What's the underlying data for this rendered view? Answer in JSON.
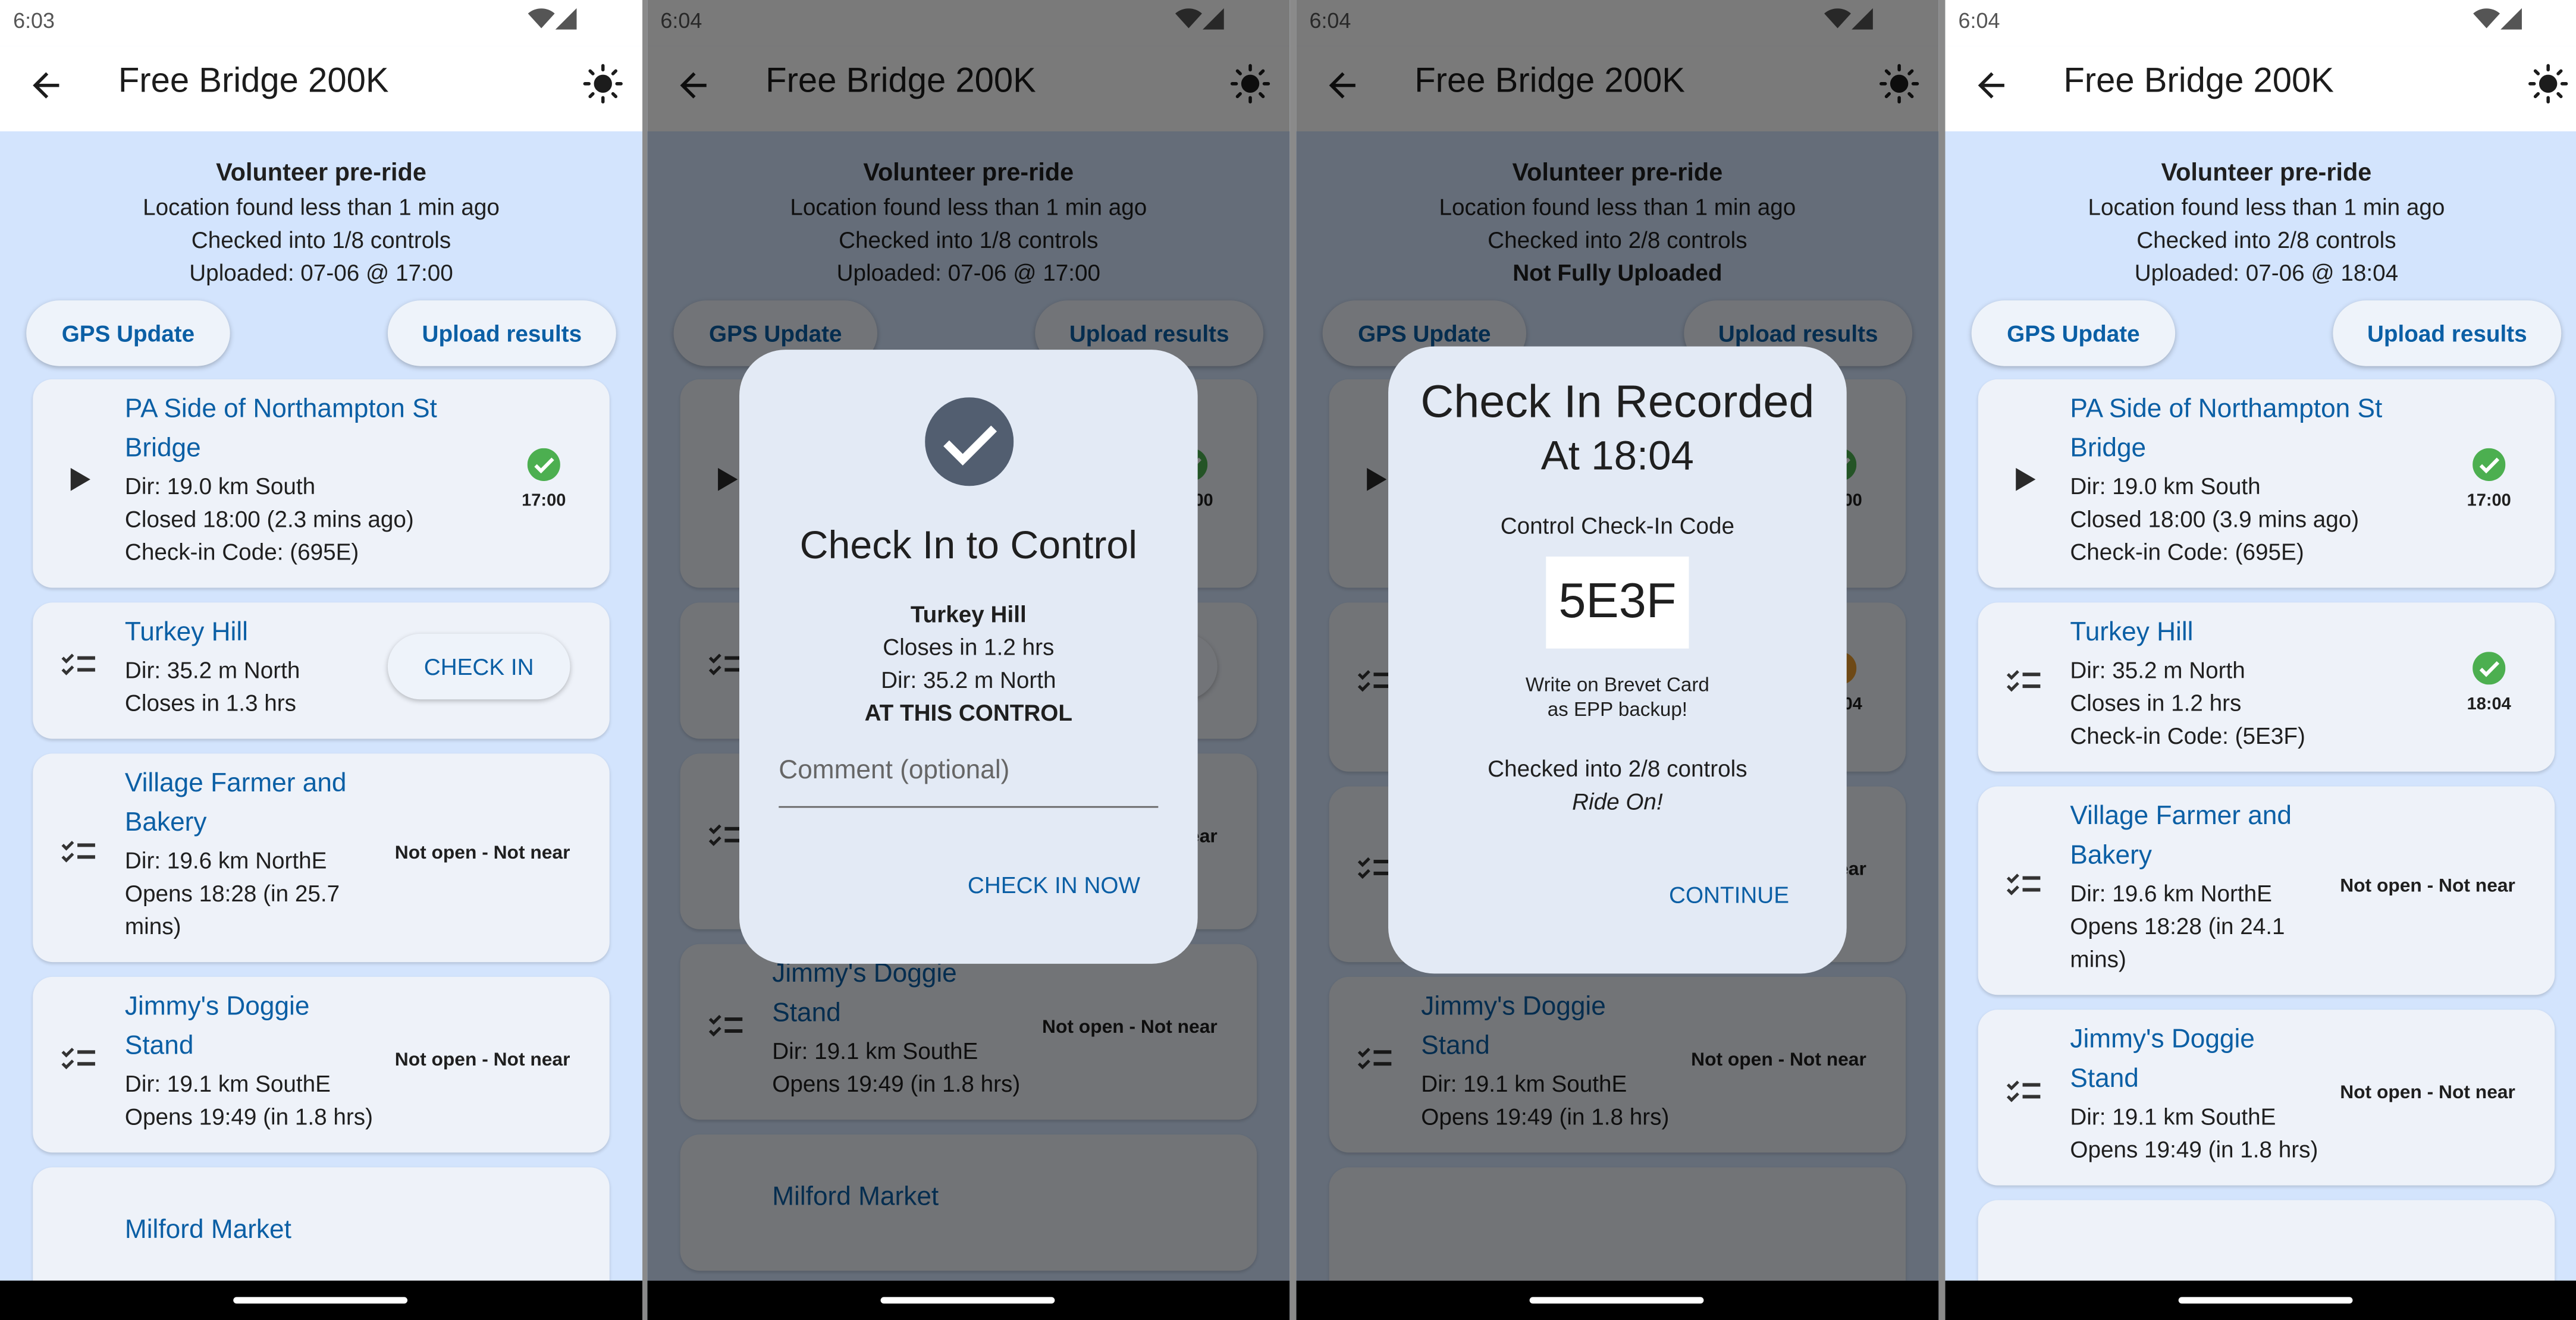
{
  "colors": {
    "accent": "#0b5fa5",
    "background": "#d3e4fd",
    "card": "#eef2f9",
    "success": "#4caf50",
    "pending": "#e69a2e",
    "dialog_icon": "#525e70"
  },
  "panels": [
    {
      "status_time": "6:03",
      "title": "Free Bridge 200K",
      "dimmed": false,
      "header": {
        "title": "Volunteer pre-ride",
        "lines": [
          {
            "text": "Location found less than 1 min  ago"
          },
          {
            "text": "Checked into 1/8 controls"
          },
          {
            "text": "Uploaded: 07-06 @ 17:00"
          }
        ]
      },
      "buttons": {
        "gps": "GPS Update",
        "upload": "Upload results"
      },
      "cards": [
        {
          "icon": "play-icon",
          "title": "PA Side of Northampton St Bridge",
          "details": [
            "Dir: 19.0 km South",
            "Closed 18:00 (2.3 mins ago)",
            "Check-in Code: (695E)"
          ],
          "trailing": {
            "type": "check",
            "status": "checked",
            "text": "17:00"
          }
        },
        {
          "icon": "checklist-icon",
          "title": "Turkey Hill",
          "details": [
            "Dir: 35.2 m North",
            "Closes in 1.3 hrs"
          ],
          "trailing": {
            "type": "button",
            "text": "CHECK IN"
          }
        },
        {
          "icon": "checklist-icon",
          "title": "Village Farmer and Bakery",
          "details": [
            "Dir: 19.6 km NorthE",
            "Opens 18:28 (in 25.7 mins)"
          ],
          "trailing": {
            "type": "text",
            "text": "Not open - Not near"
          }
        },
        {
          "icon": "checklist-icon",
          "title": "Jimmy's Doggie Stand",
          "details": [
            "Dir: 19.1 km SouthE",
            "Opens 19:49 (in 1.8 hrs)"
          ],
          "trailing": {
            "type": "text",
            "text": "Not open - Not near"
          }
        },
        {
          "icon": "",
          "title": "Milford Market",
          "details": [],
          "trailing": null
        }
      ]
    },
    {
      "status_time": "6:04",
      "title": "Free Bridge 200K",
      "dimmed": true,
      "header": {
        "title": "Volunteer pre-ride",
        "lines": [
          {
            "text": "Location found less than 1 min  ago"
          },
          {
            "text": "Checked into 1/8 controls"
          },
          {
            "text": "Uploaded: 07-06 @ 17:00"
          }
        ]
      },
      "buttons": {
        "gps": "GPS Update",
        "upload": "Upload results"
      },
      "cards": [
        {
          "icon": "play-icon",
          "title": "PA Side of Northampton St Bridge",
          "details": [
            "Dir: 19.0 km South",
            "Closed 18:00",
            "Check-in Code: (695E)"
          ],
          "trailing": {
            "type": "check",
            "status": "checked",
            "text": "17:00"
          }
        },
        {
          "icon": "checklist-icon",
          "title": "Turkey Hill",
          "details": [
            "Dir: 35.2 m North",
            "Closes in 1.2 hrs"
          ],
          "trailing": {
            "type": "button",
            "text": "CHECK IN"
          }
        },
        {
          "icon": "checklist-icon",
          "title": "Village Farmer and Bakery",
          "details": [
            "Dir: 19.6 km NorthE",
            "Opens 18:28"
          ],
          "trailing": {
            "type": "text",
            "text": "Not open - Not near"
          }
        },
        {
          "icon": "checklist-icon",
          "title": "Jimmy's Doggie Stand",
          "details": [
            "Dir: 19.1 km SouthE",
            "Opens 19:49 (in 1.8 hrs)"
          ],
          "trailing": {
            "type": "text",
            "text": "Not open - Not near"
          }
        },
        {
          "icon": "",
          "title": "Milford Market",
          "details": [],
          "trailing": null
        }
      ],
      "dialog": {
        "kind": "checkin",
        "icon": "check-circle-icon",
        "title": "Check In to Control",
        "control_name": "Turkey Hill",
        "closes": "Closes in 1.2 hrs",
        "direction": "Dir: 35.2 m North",
        "location_status": "AT THIS CONTROL",
        "comment_placeholder": "Comment (optional)",
        "action": "CHECK IN NOW"
      }
    },
    {
      "status_time": "6:04",
      "title": "Free Bridge 200K",
      "dimmed": true,
      "header": {
        "title": "Volunteer pre-ride",
        "lines": [
          {
            "text": "Location found less than 1 min  ago"
          },
          {
            "text": "Checked into 2/8 controls"
          },
          {
            "text": "Not Fully Uploaded",
            "emphasis": true
          }
        ]
      },
      "buttons": {
        "gps": "GPS Update",
        "upload": "Upload results"
      },
      "cards": [
        {
          "icon": "play-icon",
          "title": "PA Side of Northampton St Bridge",
          "details": [
            "Dir: 19.0 km South",
            "Closed 18:00",
            "Check-in Code: (695E)"
          ],
          "trailing": {
            "type": "check",
            "status": "checked",
            "text": "17:00"
          }
        },
        {
          "icon": "checklist-icon",
          "title": "Turkey Hill",
          "details": [
            "Dir: 35.2 m North",
            "Closes in 1.2 hrs",
            "Check-in Code: (5E3F)"
          ],
          "trailing": {
            "type": "check",
            "status": "pending",
            "text": "18:04"
          }
        },
        {
          "icon": "checklist-icon",
          "title": "Village Farmer and Bakery",
          "details": [
            "Dir: 19.6 km NorthE",
            "Opens 18:28"
          ],
          "trailing": {
            "type": "text",
            "text": "Not open - Not near"
          }
        },
        {
          "icon": "checklist-icon",
          "title": "Jimmy's Doggie Stand",
          "details": [
            "Dir: 19.1 km SouthE",
            "Opens 19:49 (in 1.8 hrs)"
          ],
          "trailing": {
            "type": "text",
            "text": "Not open - Not near"
          }
        },
        {
          "icon": "",
          "title": "",
          "details": [],
          "trailing": null
        }
      ],
      "dialog": {
        "kind": "recorded",
        "title": "Check In Recorded",
        "subtitle": "At 18:04",
        "code_label": "Control Check-In Code",
        "code": "5E3F",
        "note_1": "Write on Brevet Card",
        "note_2": "as EPP backup!",
        "progress": "Checked into 2/8 controls",
        "cheer": "Ride On!",
        "action": "CONTINUE"
      }
    },
    {
      "status_time": "6:04",
      "title": "Free Bridge 200K",
      "dimmed": false,
      "header": {
        "title": "Volunteer pre-ride",
        "lines": [
          {
            "text": "Location found less than 1 min  ago"
          },
          {
            "text": "Checked into 2/8 controls"
          },
          {
            "text": "Uploaded: 07-06 @ 18:04"
          }
        ]
      },
      "buttons": {
        "gps": "GPS Update",
        "upload": "Upload results"
      },
      "cards": [
        {
          "icon": "play-icon",
          "title": "PA Side of Northampton St Bridge",
          "details": [
            "Dir: 19.0 km South",
            "Closed 18:00 (3.9 mins ago)",
            "Check-in Code: (695E)"
          ],
          "trailing": {
            "type": "check",
            "status": "checked",
            "text": "17:00"
          }
        },
        {
          "icon": "checklist-icon",
          "title": "Turkey Hill",
          "details": [
            "Dir: 35.2 m North",
            "Closes in 1.2 hrs",
            "Check-in Code: (5E3F)"
          ],
          "trailing": {
            "type": "check",
            "status": "checked",
            "text": "18:04"
          }
        },
        {
          "icon": "checklist-icon",
          "title": "Village Farmer and Bakery",
          "details": [
            "Dir: 19.6 km NorthE",
            "Opens 18:28 (in 24.1 mins)"
          ],
          "trailing": {
            "type": "text",
            "text": "Not open - Not near"
          }
        },
        {
          "icon": "checklist-icon",
          "title": "Jimmy's Doggie Stand",
          "details": [
            "Dir: 19.1 km SouthE",
            "Opens 19:49 (in 1.8 hrs)"
          ],
          "trailing": {
            "type": "text",
            "text": "Not open - Not near"
          }
        },
        {
          "icon": "",
          "title": "",
          "details": [],
          "trailing": null
        }
      ]
    }
  ]
}
